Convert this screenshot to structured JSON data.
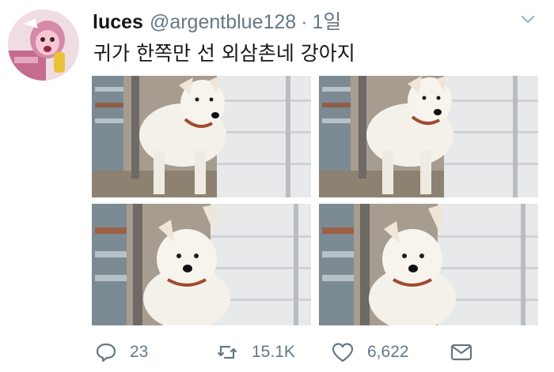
{
  "tweet": {
    "display_name": "luces",
    "handle": "@argentblue128",
    "separator": "·",
    "timestamp": "1일",
    "text": "귀가 한쪽만 선 외삼촌네 강아지"
  },
  "media": {
    "photo_count": 4
  },
  "actions": {
    "reply_count": "23",
    "retweet_count": "15.1K",
    "like_count": "6,622"
  },
  "icons": {
    "reply": "reply-icon",
    "retweet": "retweet-icon",
    "like": "like-icon",
    "dm": "direct-message-icon",
    "menu": "chevron-down-icon"
  },
  "colors": {
    "text": "#14171a",
    "secondary": "#657786"
  }
}
